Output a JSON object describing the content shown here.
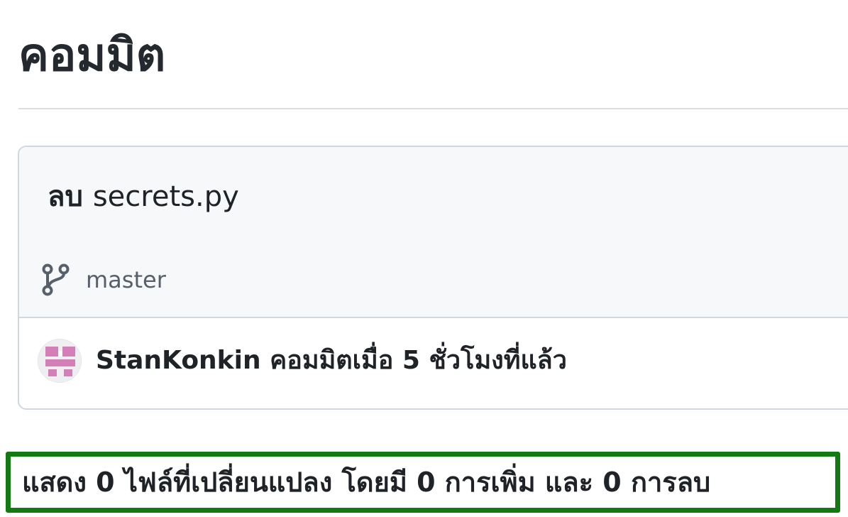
{
  "page": {
    "title": "คอมมิต"
  },
  "commit": {
    "title_action": "ลบ",
    "title_filename": "secrets.py",
    "branch": {
      "icon": "git-branch-icon",
      "name": "master"
    },
    "author": {
      "avatar": "identicon-avatar",
      "avatar_color": "#d57fb8",
      "name": "StanKonkin",
      "committed_text": "คอมมิตเมื่อ 5 ชั่วโมงที่แล้ว"
    }
  },
  "summary": {
    "text": "แสดง 0 ไฟล์ที่เปลี่ยนแปลง โดยมี 0 การเพิ่ม และ 0 การลบ",
    "highlight_color": "#137a13"
  }
}
